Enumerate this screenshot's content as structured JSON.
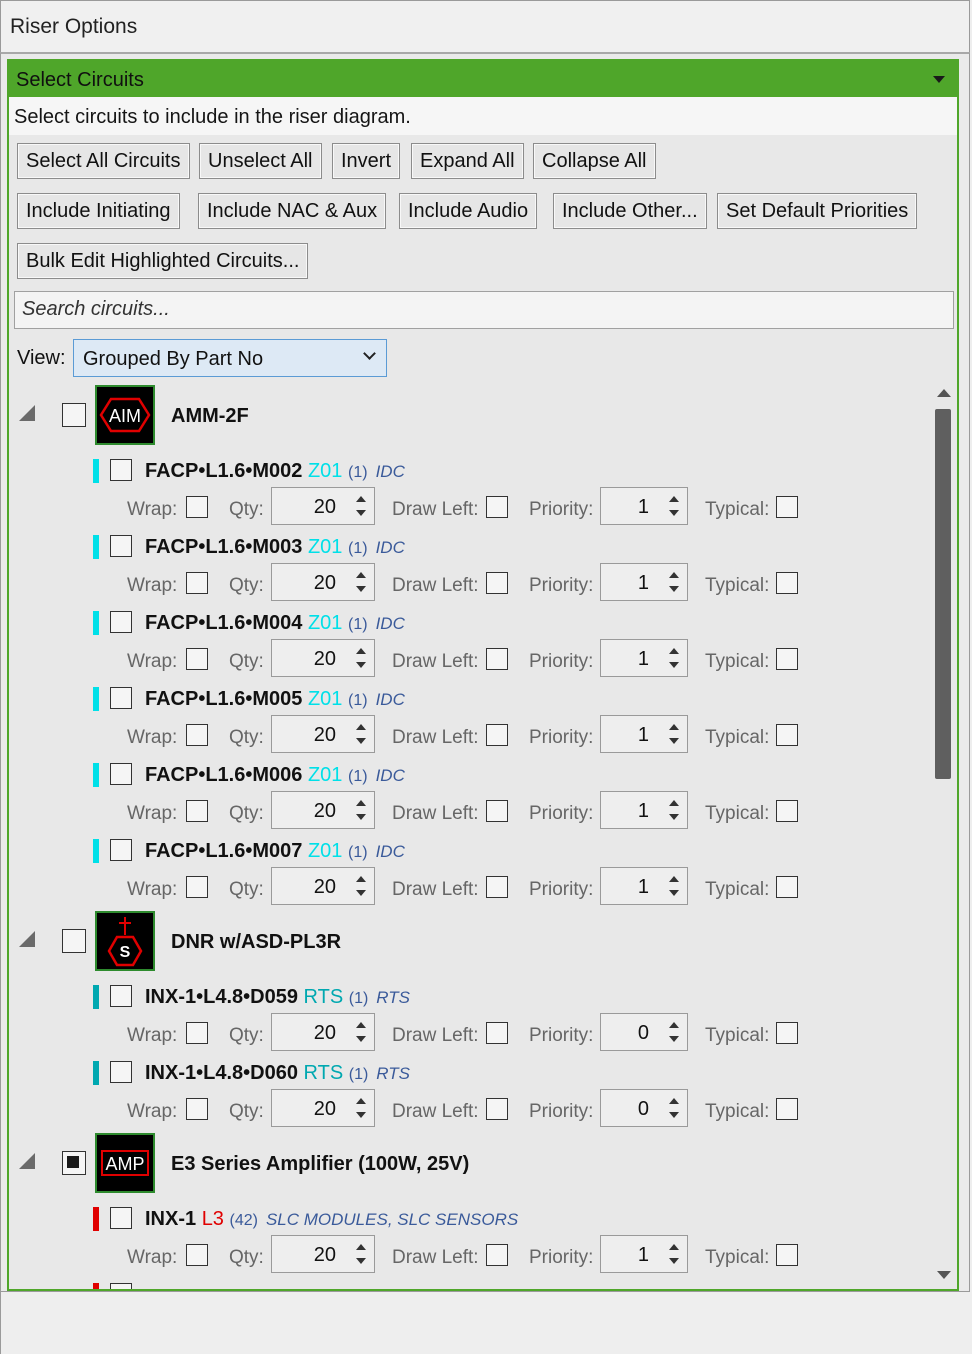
{
  "window": {
    "title": "Riser Options"
  },
  "panel": {
    "title": "Select Circuits",
    "description": "Select circuits to include in the riser diagram."
  },
  "toolbar": {
    "select_all": "Select All Circuits",
    "unselect_all": "Unselect All",
    "invert": "Invert",
    "expand_all": "Expand All",
    "collapse_all": "Collapse All",
    "include_initiating": "Include Initiating",
    "include_nac_aux": "Include NAC & Aux",
    "include_audio": "Include Audio",
    "include_other": "Include Other...",
    "set_default_priorities": "Set Default Priorities",
    "bulk_edit": "Bulk Edit Highlighted Circuits..."
  },
  "search": {
    "placeholder": "Search circuits...",
    "value": ""
  },
  "view": {
    "label": "View:",
    "selected": "Grouped By Part No"
  },
  "fields": {
    "wrap": "Wrap:",
    "qty": "Qty:",
    "draw_left": "Draw Left:",
    "priority": "Priority:",
    "typical": "Typical:"
  },
  "colors": {
    "accent_green": "#4fa62a",
    "zone_cyan": "#00e0e8",
    "rts_teal": "#00a8b0",
    "l3_red": "#e00000",
    "muted_blue": "#3a5a9a"
  },
  "groups": [
    {
      "name": "AMM-2F",
      "icon_text": "AIM",
      "icon": "hexagon-aim-icon",
      "circuits": [
        {
          "name": "FACP•L1.6•M002",
          "zone": "Z01",
          "count": "(1)",
          "type": "IDC",
          "qty": "20",
          "priority": "1"
        },
        {
          "name": "FACP•L1.6•M003",
          "zone": "Z01",
          "count": "(1)",
          "type": "IDC",
          "qty": "20",
          "priority": "1"
        },
        {
          "name": "FACP•L1.6•M004",
          "zone": "Z01",
          "count": "(1)",
          "type": "IDC",
          "qty": "20",
          "priority": "1"
        },
        {
          "name": "FACP•L1.6•M005",
          "zone": "Z01",
          "count": "(1)",
          "type": "IDC",
          "qty": "20",
          "priority": "1"
        },
        {
          "name": "FACP•L1.6•M006",
          "zone": "Z01",
          "count": "(1)",
          "type": "IDC",
          "qty": "20",
          "priority": "1"
        },
        {
          "name": "FACP•L1.6•M007",
          "zone": "Z01",
          "count": "(1)",
          "type": "IDC",
          "qty": "20",
          "priority": "1"
        }
      ]
    },
    {
      "name": "DNR w/ASD-PL3R",
      "icon_text": "S",
      "icon": "duct-detector-icon",
      "circuits": [
        {
          "name": "INX-1•L4.8•D059",
          "zone": "RTS",
          "count": "(1)",
          "type": "RTS",
          "qty": "20",
          "priority": "0"
        },
        {
          "name": "INX-1•L4.8•D060",
          "zone": "RTS",
          "count": "(1)",
          "type": "RTS",
          "qty": "20",
          "priority": "0"
        }
      ]
    },
    {
      "name": "E3 Series Amplifier (100W, 25V)",
      "icon_text": "AMP",
      "icon": "amplifier-icon",
      "circuits": [
        {
          "name": "INX-1",
          "zone": "L3",
          "count": "(42)",
          "type": "SLC MODULES, SLC SENSORS",
          "qty": "20",
          "priority": "1"
        }
      ]
    }
  ]
}
